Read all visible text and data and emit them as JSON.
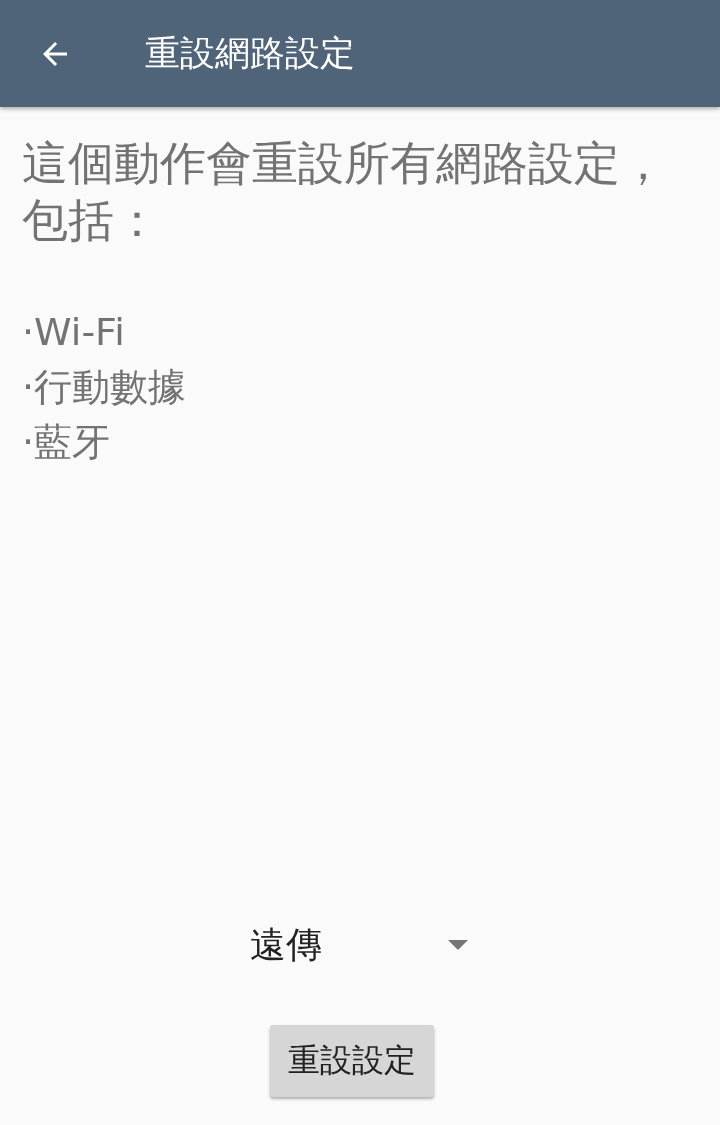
{
  "app_bar": {
    "title": "重設網路設定"
  },
  "description": "這個動作會重設所有網路設定，包括：",
  "items": [
    "·Wi-Fi",
    "·行動數據",
    "·藍牙"
  ],
  "carrier_spinner": {
    "value": "遠傳"
  },
  "reset_button": {
    "label": "重設設定"
  }
}
